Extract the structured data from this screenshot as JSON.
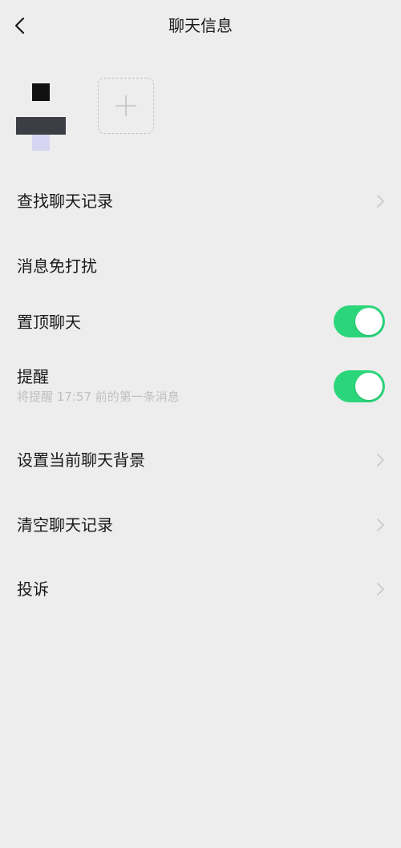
{
  "header": {
    "title": "聊天信息",
    "back_icon": "chevron-left-icon"
  },
  "members": {
    "add_icon": "plus-icon",
    "avatar_colors": [
      "#111111",
      "#3d3e45",
      "#d6d6f2"
    ]
  },
  "menu": {
    "search_history": "查找聊天记录",
    "do_not_disturb": "消息免打扰",
    "pin_chat": "置顶聊天",
    "pin_chat_on": true,
    "reminder": "提醒",
    "reminder_sub": "将提醒 17:57 前的第一条消息",
    "reminder_on": true,
    "set_background": "设置当前聊天背景",
    "clear_history": "清空聊天记录",
    "report": "投诉"
  },
  "colors": {
    "accent": "#2bd67a",
    "background": "#ededed",
    "chevron": "#c8c8c8"
  }
}
